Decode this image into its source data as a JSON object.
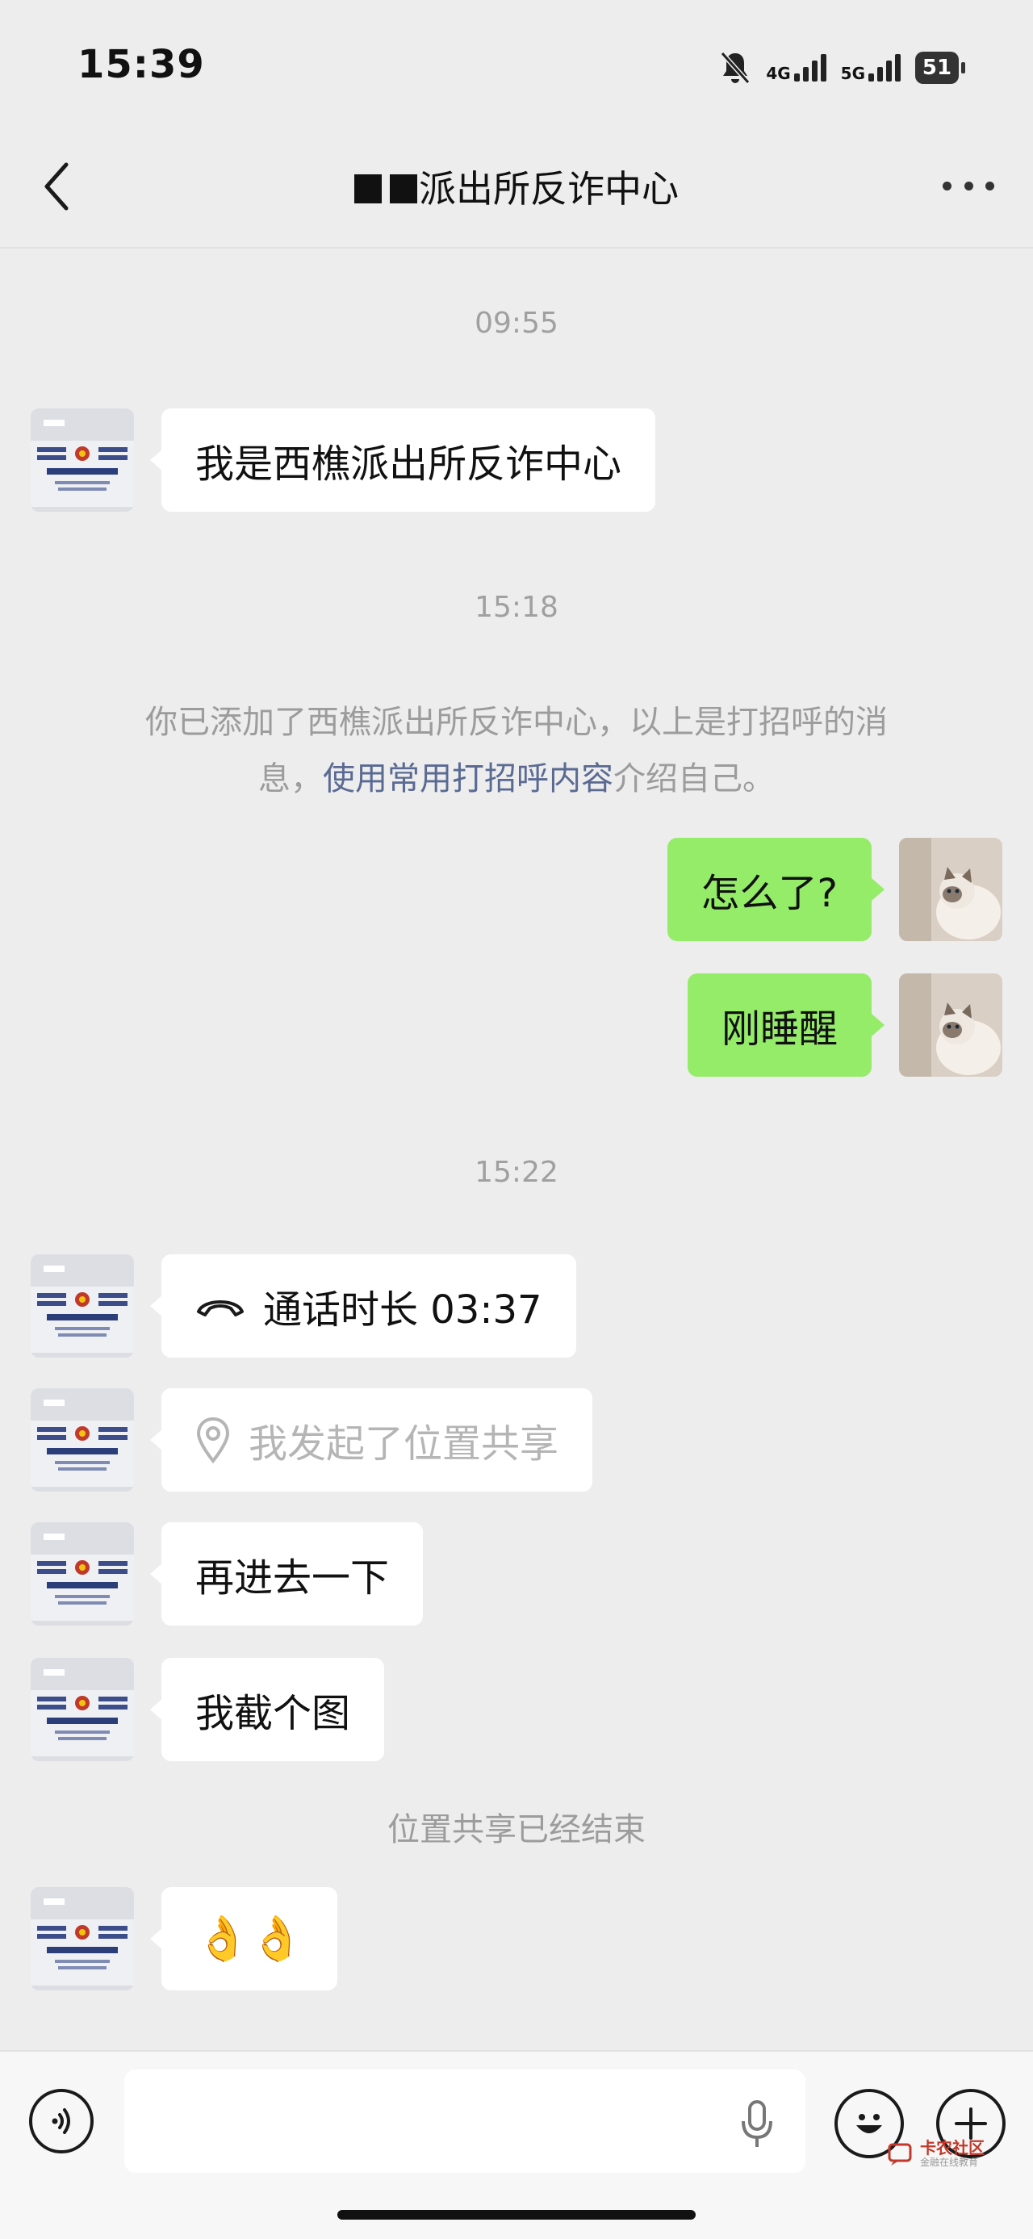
{
  "status_bar": {
    "time": "15:39",
    "net_4g": "4G",
    "net_5g": "5G",
    "battery": "51"
  },
  "nav": {
    "title": "派出所反诈中心",
    "icons": {
      "back": "chevron-left-icon",
      "more": "ellipsis-icon"
    }
  },
  "timestamps": [
    "09:55",
    "15:18",
    "15:22"
  ],
  "messages": {
    "m1": "我是西樵派出所反诈中心",
    "m2": "怎么了?",
    "m3": "刚睡醒",
    "m4_label": "通话时长 03:37",
    "m5": "我发起了位置共享",
    "m6": "再进去一下",
    "m7": "我截个图",
    "m8": "👌👌"
  },
  "system": {
    "added_part1": "你已添加了西樵派出所反诈中心，以上是打招呼的消",
    "added_part2": "息，",
    "added_link": "使用常用打招呼内容",
    "added_part3": "介绍自己。",
    "location_ended": "位置共享已经结束"
  },
  "watermark": {
    "main": "卡农社区",
    "sub": "金融在线教育"
  },
  "colors": {
    "background": "#ededed",
    "bubble_self": "#95ec69",
    "bubble_other": "#ffffff",
    "link": "#5a6a93"
  }
}
